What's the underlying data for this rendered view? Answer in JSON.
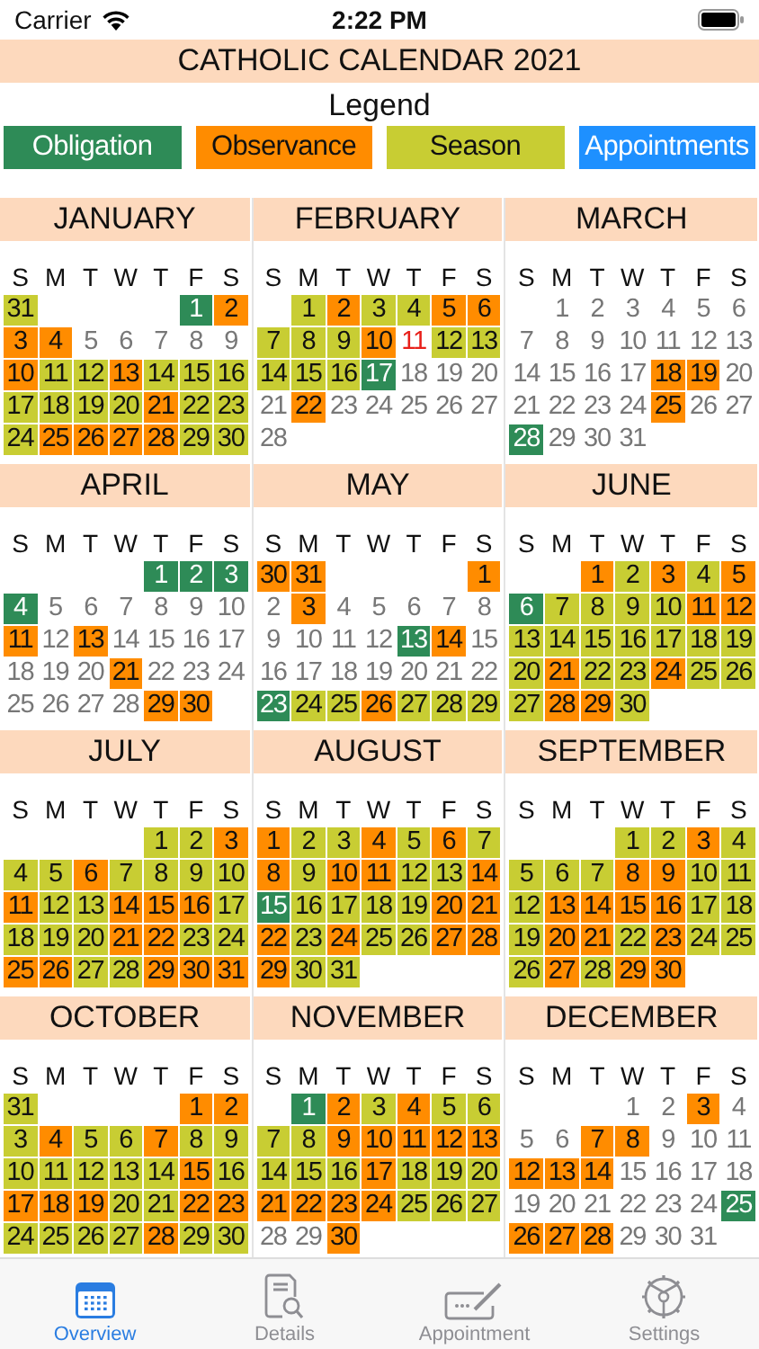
{
  "status_bar": {
    "carrier": "Carrier",
    "time": "2:22 PM"
  },
  "title": "CATHOLIC CALENDAR 2021",
  "legend": {
    "heading": "Legend",
    "items": [
      {
        "label": "Obligation",
        "kind": "obligation"
      },
      {
        "label": "Observance",
        "kind": "observance"
      },
      {
        "label": "Season",
        "kind": "season"
      },
      {
        "label": "Appointments",
        "kind": "appointment"
      }
    ]
  },
  "months": [
    {
      "name": "JANUARY",
      "weekdays": [
        "S",
        "M",
        "T",
        "W",
        "T",
        "F",
        "S"
      ],
      "weeks": [
        [
          {
            "day": "31",
            "kind": "season"
          },
          {
            "kind": "blank"
          },
          {
            "kind": "blank"
          },
          {
            "kind": "blank"
          },
          {
            "kind": "blank"
          },
          {
            "day": "1",
            "kind": "obligation"
          },
          {
            "day": "2",
            "kind": "observance"
          }
        ],
        [
          {
            "day": "3",
            "kind": "observance"
          },
          {
            "day": "4",
            "kind": "observance"
          },
          {
            "day": "5",
            "kind": "plain"
          },
          {
            "day": "6",
            "kind": "plain"
          },
          {
            "day": "7",
            "kind": "plain"
          },
          {
            "day": "8",
            "kind": "plain"
          },
          {
            "day": "9",
            "kind": "plain"
          }
        ],
        [
          {
            "day": "10",
            "kind": "observance"
          },
          {
            "day": "11",
            "kind": "season"
          },
          {
            "day": "12",
            "kind": "season"
          },
          {
            "day": "13",
            "kind": "observance"
          },
          {
            "day": "14",
            "kind": "season"
          },
          {
            "day": "15",
            "kind": "season"
          },
          {
            "day": "16",
            "kind": "season"
          }
        ],
        [
          {
            "day": "17",
            "kind": "season"
          },
          {
            "day": "18",
            "kind": "season"
          },
          {
            "day": "19",
            "kind": "season"
          },
          {
            "day": "20",
            "kind": "season"
          },
          {
            "day": "21",
            "kind": "observance"
          },
          {
            "day": "22",
            "kind": "season"
          },
          {
            "day": "23",
            "kind": "season"
          }
        ],
        [
          {
            "day": "24",
            "kind": "season"
          },
          {
            "day": "25",
            "kind": "observance"
          },
          {
            "day": "26",
            "kind": "observance"
          },
          {
            "day": "27",
            "kind": "observance"
          },
          {
            "day": "28",
            "kind": "observance"
          },
          {
            "day": "29",
            "kind": "season"
          },
          {
            "day": "30",
            "kind": "season"
          }
        ]
      ]
    },
    {
      "name": "FEBRUARY",
      "weekdays": [
        "S",
        "M",
        "T",
        "W",
        "T",
        "F",
        "S"
      ],
      "weeks": [
        [
          {
            "kind": "blank"
          },
          {
            "day": "1",
            "kind": "season"
          },
          {
            "day": "2",
            "kind": "observance"
          },
          {
            "day": "3",
            "kind": "season"
          },
          {
            "day": "4",
            "kind": "season"
          },
          {
            "day": "5",
            "kind": "observance"
          },
          {
            "day": "6",
            "kind": "observance"
          }
        ],
        [
          {
            "day": "7",
            "kind": "season"
          },
          {
            "day": "8",
            "kind": "season"
          },
          {
            "day": "9",
            "kind": "season"
          },
          {
            "day": "10",
            "kind": "observance"
          },
          {
            "day": "11",
            "kind": "highlight"
          },
          {
            "day": "12",
            "kind": "season"
          },
          {
            "day": "13",
            "kind": "season"
          }
        ],
        [
          {
            "day": "14",
            "kind": "season"
          },
          {
            "day": "15",
            "kind": "season"
          },
          {
            "day": "16",
            "kind": "season"
          },
          {
            "day": "17",
            "kind": "obligation"
          },
          {
            "day": "18",
            "kind": "plain"
          },
          {
            "day": "19",
            "kind": "plain"
          },
          {
            "day": "20",
            "kind": "plain"
          }
        ],
        [
          {
            "day": "21",
            "kind": "plain"
          },
          {
            "day": "22",
            "kind": "observance"
          },
          {
            "day": "23",
            "kind": "plain"
          },
          {
            "day": "24",
            "kind": "plain"
          },
          {
            "day": "25",
            "kind": "plain"
          },
          {
            "day": "26",
            "kind": "plain"
          },
          {
            "day": "27",
            "kind": "plain"
          }
        ],
        [
          {
            "day": "28",
            "kind": "plain"
          }
        ]
      ]
    },
    {
      "name": "MARCH",
      "weekdays": [
        "S",
        "M",
        "T",
        "W",
        "T",
        "F",
        "S"
      ],
      "weeks": [
        [
          {
            "kind": "blank"
          },
          {
            "day": "1",
            "kind": "plain"
          },
          {
            "day": "2",
            "kind": "plain"
          },
          {
            "day": "3",
            "kind": "plain"
          },
          {
            "day": "4",
            "kind": "plain"
          },
          {
            "day": "5",
            "kind": "plain"
          },
          {
            "day": "6",
            "kind": "plain"
          }
        ],
        [
          {
            "day": "7",
            "kind": "plain"
          },
          {
            "day": "8",
            "kind": "plain"
          },
          {
            "day": "9",
            "kind": "plain"
          },
          {
            "day": "10",
            "kind": "plain"
          },
          {
            "day": "11",
            "kind": "plain"
          },
          {
            "day": "12",
            "kind": "plain"
          },
          {
            "day": "13",
            "kind": "plain"
          }
        ],
        [
          {
            "day": "14",
            "kind": "plain"
          },
          {
            "day": "15",
            "kind": "plain"
          },
          {
            "day": "16",
            "kind": "plain"
          },
          {
            "day": "17",
            "kind": "plain"
          },
          {
            "day": "18",
            "kind": "observance"
          },
          {
            "day": "19",
            "kind": "observance"
          },
          {
            "day": "20",
            "kind": "plain"
          }
        ],
        [
          {
            "day": "21",
            "kind": "plain"
          },
          {
            "day": "22",
            "kind": "plain"
          },
          {
            "day": "23",
            "kind": "plain"
          },
          {
            "day": "24",
            "kind": "plain"
          },
          {
            "day": "25",
            "kind": "observance"
          },
          {
            "day": "26",
            "kind": "plain"
          },
          {
            "day": "27",
            "kind": "plain"
          }
        ],
        [
          {
            "day": "28",
            "kind": "obligation"
          },
          {
            "day": "29",
            "kind": "plain"
          },
          {
            "day": "30",
            "kind": "plain"
          },
          {
            "day": "31",
            "kind": "plain"
          }
        ]
      ]
    },
    {
      "name": "APRIL",
      "weekdays": [
        "S",
        "M",
        "T",
        "W",
        "T",
        "F",
        "S"
      ],
      "weeks": [
        [
          {
            "kind": "blank"
          },
          {
            "kind": "blank"
          },
          {
            "kind": "blank"
          },
          {
            "kind": "blank"
          },
          {
            "day": "1",
            "kind": "obligation"
          },
          {
            "day": "2",
            "kind": "obligation"
          },
          {
            "day": "3",
            "kind": "obligation"
          }
        ],
        [
          {
            "day": "4",
            "kind": "obligation"
          },
          {
            "day": "5",
            "kind": "plain"
          },
          {
            "day": "6",
            "kind": "plain"
          },
          {
            "day": "7",
            "kind": "plain"
          },
          {
            "day": "8",
            "kind": "plain"
          },
          {
            "day": "9",
            "kind": "plain"
          },
          {
            "day": "10",
            "kind": "plain"
          }
        ],
        [
          {
            "day": "11",
            "kind": "observance"
          },
          {
            "day": "12",
            "kind": "plain"
          },
          {
            "day": "13",
            "kind": "observance"
          },
          {
            "day": "14",
            "kind": "plain"
          },
          {
            "day": "15",
            "kind": "plain"
          },
          {
            "day": "16",
            "kind": "plain"
          },
          {
            "day": "17",
            "kind": "plain"
          }
        ],
        [
          {
            "day": "18",
            "kind": "plain"
          },
          {
            "day": "19",
            "kind": "plain"
          },
          {
            "day": "20",
            "kind": "plain"
          },
          {
            "day": "21",
            "kind": "observance"
          },
          {
            "day": "22",
            "kind": "plain"
          },
          {
            "day": "23",
            "kind": "plain"
          },
          {
            "day": "24",
            "kind": "plain"
          }
        ],
        [
          {
            "day": "25",
            "kind": "plain"
          },
          {
            "day": "26",
            "kind": "plain"
          },
          {
            "day": "27",
            "kind": "plain"
          },
          {
            "day": "28",
            "kind": "plain"
          },
          {
            "day": "29",
            "kind": "observance"
          },
          {
            "day": "30",
            "kind": "observance"
          }
        ]
      ]
    },
    {
      "name": "MAY",
      "weekdays": [
        "S",
        "M",
        "T",
        "W",
        "T",
        "F",
        "S"
      ],
      "weeks": [
        [
          {
            "day": "30",
            "kind": "observance"
          },
          {
            "day": "31",
            "kind": "observance"
          },
          {
            "kind": "blank"
          },
          {
            "kind": "blank"
          },
          {
            "kind": "blank"
          },
          {
            "kind": "blank"
          },
          {
            "day": "1",
            "kind": "observance"
          }
        ],
        [
          {
            "day": "2",
            "kind": "plain"
          },
          {
            "day": "3",
            "kind": "observance"
          },
          {
            "day": "4",
            "kind": "plain"
          },
          {
            "day": "5",
            "kind": "plain"
          },
          {
            "day": "6",
            "kind": "plain"
          },
          {
            "day": "7",
            "kind": "plain"
          },
          {
            "day": "8",
            "kind": "plain"
          }
        ],
        [
          {
            "day": "9",
            "kind": "plain"
          },
          {
            "day": "10",
            "kind": "plain"
          },
          {
            "day": "11",
            "kind": "plain"
          },
          {
            "day": "12",
            "kind": "plain"
          },
          {
            "day": "13",
            "kind": "obligation"
          },
          {
            "day": "14",
            "kind": "observance"
          },
          {
            "day": "15",
            "kind": "plain"
          }
        ],
        [
          {
            "day": "16",
            "kind": "plain"
          },
          {
            "day": "17",
            "kind": "plain"
          },
          {
            "day": "18",
            "kind": "plain"
          },
          {
            "day": "19",
            "kind": "plain"
          },
          {
            "day": "20",
            "kind": "plain"
          },
          {
            "day": "21",
            "kind": "plain"
          },
          {
            "day": "22",
            "kind": "plain"
          }
        ],
        [
          {
            "day": "23",
            "kind": "obligation"
          },
          {
            "day": "24",
            "kind": "season"
          },
          {
            "day": "25",
            "kind": "season"
          },
          {
            "day": "26",
            "kind": "observance"
          },
          {
            "day": "27",
            "kind": "season"
          },
          {
            "day": "28",
            "kind": "season"
          },
          {
            "day": "29",
            "kind": "season"
          }
        ]
      ]
    },
    {
      "name": "JUNE",
      "weekdays": [
        "S",
        "M",
        "T",
        "W",
        "T",
        "F",
        "S"
      ],
      "weeks": [
        [
          {
            "kind": "blank"
          },
          {
            "kind": "blank"
          },
          {
            "day": "1",
            "kind": "observance"
          },
          {
            "day": "2",
            "kind": "season"
          },
          {
            "day": "3",
            "kind": "observance"
          },
          {
            "day": "4",
            "kind": "season"
          },
          {
            "day": "5",
            "kind": "observance"
          }
        ],
        [
          {
            "day": "6",
            "kind": "obligation"
          },
          {
            "day": "7",
            "kind": "season"
          },
          {
            "day": "8",
            "kind": "season"
          },
          {
            "day": "9",
            "kind": "season"
          },
          {
            "day": "10",
            "kind": "season"
          },
          {
            "day": "11",
            "kind": "observance"
          },
          {
            "day": "12",
            "kind": "observance"
          }
        ],
        [
          {
            "day": "13",
            "kind": "season"
          },
          {
            "day": "14",
            "kind": "season"
          },
          {
            "day": "15",
            "kind": "season"
          },
          {
            "day": "16",
            "kind": "season"
          },
          {
            "day": "17",
            "kind": "season"
          },
          {
            "day": "18",
            "kind": "season"
          },
          {
            "day": "19",
            "kind": "season"
          }
        ],
        [
          {
            "day": "20",
            "kind": "season"
          },
          {
            "day": "21",
            "kind": "observance"
          },
          {
            "day": "22",
            "kind": "season"
          },
          {
            "day": "23",
            "kind": "season"
          },
          {
            "day": "24",
            "kind": "observance"
          },
          {
            "day": "25",
            "kind": "season"
          },
          {
            "day": "26",
            "kind": "season"
          }
        ],
        [
          {
            "day": "27",
            "kind": "season"
          },
          {
            "day": "28",
            "kind": "observance"
          },
          {
            "day": "29",
            "kind": "observance"
          },
          {
            "day": "30",
            "kind": "season"
          }
        ]
      ]
    },
    {
      "name": "JULY",
      "weekdays": [
        "S",
        "M",
        "T",
        "W",
        "T",
        "F",
        "S"
      ],
      "weeks": [
        [
          {
            "kind": "blank"
          },
          {
            "kind": "blank"
          },
          {
            "kind": "blank"
          },
          {
            "kind": "blank"
          },
          {
            "day": "1",
            "kind": "season"
          },
          {
            "day": "2",
            "kind": "season"
          },
          {
            "day": "3",
            "kind": "observance"
          }
        ],
        [
          {
            "day": "4",
            "kind": "season"
          },
          {
            "day": "5",
            "kind": "season"
          },
          {
            "day": "6",
            "kind": "observance"
          },
          {
            "day": "7",
            "kind": "season"
          },
          {
            "day": "8",
            "kind": "season"
          },
          {
            "day": "9",
            "kind": "season"
          },
          {
            "day": "10",
            "kind": "season"
          }
        ],
        [
          {
            "day": "11",
            "kind": "observance"
          },
          {
            "day": "12",
            "kind": "season"
          },
          {
            "day": "13",
            "kind": "season"
          },
          {
            "day": "14",
            "kind": "observance"
          },
          {
            "day": "15",
            "kind": "observance"
          },
          {
            "day": "16",
            "kind": "observance"
          },
          {
            "day": "17",
            "kind": "season"
          }
        ],
        [
          {
            "day": "18",
            "kind": "season"
          },
          {
            "day": "19",
            "kind": "season"
          },
          {
            "day": "20",
            "kind": "season"
          },
          {
            "day": "21",
            "kind": "observance"
          },
          {
            "day": "22",
            "kind": "observance"
          },
          {
            "day": "23",
            "kind": "season"
          },
          {
            "day": "24",
            "kind": "season"
          }
        ],
        [
          {
            "day": "25",
            "kind": "observance"
          },
          {
            "day": "26",
            "kind": "observance"
          },
          {
            "day": "27",
            "kind": "season"
          },
          {
            "day": "28",
            "kind": "season"
          },
          {
            "day": "29",
            "kind": "observance"
          },
          {
            "day": "30",
            "kind": "observance"
          },
          {
            "day": "31",
            "kind": "observance"
          }
        ]
      ]
    },
    {
      "name": "AUGUST",
      "weekdays": [
        "S",
        "M",
        "T",
        "W",
        "T",
        "F",
        "S"
      ],
      "weeks": [
        [
          {
            "day": "1",
            "kind": "observance"
          },
          {
            "day": "2",
            "kind": "season"
          },
          {
            "day": "3",
            "kind": "season"
          },
          {
            "day": "4",
            "kind": "observance"
          },
          {
            "day": "5",
            "kind": "season"
          },
          {
            "day": "6",
            "kind": "observance"
          },
          {
            "day": "7",
            "kind": "season"
          }
        ],
        [
          {
            "day": "8",
            "kind": "observance"
          },
          {
            "day": "9",
            "kind": "season"
          },
          {
            "day": "10",
            "kind": "observance"
          },
          {
            "day": "11",
            "kind": "observance"
          },
          {
            "day": "12",
            "kind": "season"
          },
          {
            "day": "13",
            "kind": "season"
          },
          {
            "day": "14",
            "kind": "observance"
          }
        ],
        [
          {
            "day": "15",
            "kind": "obligation"
          },
          {
            "day": "16",
            "kind": "season"
          },
          {
            "day": "17",
            "kind": "season"
          },
          {
            "day": "18",
            "kind": "season"
          },
          {
            "day": "19",
            "kind": "season"
          },
          {
            "day": "20",
            "kind": "observance"
          },
          {
            "day": "21",
            "kind": "observance"
          }
        ],
        [
          {
            "day": "22",
            "kind": "observance"
          },
          {
            "day": "23",
            "kind": "season"
          },
          {
            "day": "24",
            "kind": "observance"
          },
          {
            "day": "25",
            "kind": "season"
          },
          {
            "day": "26",
            "kind": "season"
          },
          {
            "day": "27",
            "kind": "observance"
          },
          {
            "day": "28",
            "kind": "observance"
          }
        ],
        [
          {
            "day": "29",
            "kind": "observance"
          },
          {
            "day": "30",
            "kind": "season"
          },
          {
            "day": "31",
            "kind": "season"
          }
        ]
      ]
    },
    {
      "name": "SEPTEMBER",
      "weekdays": [
        "S",
        "M",
        "T",
        "W",
        "T",
        "F",
        "S"
      ],
      "weeks": [
        [
          {
            "kind": "blank"
          },
          {
            "kind": "blank"
          },
          {
            "kind": "blank"
          },
          {
            "day": "1",
            "kind": "season"
          },
          {
            "day": "2",
            "kind": "season"
          },
          {
            "day": "3",
            "kind": "observance"
          },
          {
            "day": "4",
            "kind": "season"
          }
        ],
        [
          {
            "day": "5",
            "kind": "season"
          },
          {
            "day": "6",
            "kind": "season"
          },
          {
            "day": "7",
            "kind": "season"
          },
          {
            "day": "8",
            "kind": "observance"
          },
          {
            "day": "9",
            "kind": "observance"
          },
          {
            "day": "10",
            "kind": "season"
          },
          {
            "day": "11",
            "kind": "season"
          }
        ],
        [
          {
            "day": "12",
            "kind": "season"
          },
          {
            "day": "13",
            "kind": "observance"
          },
          {
            "day": "14",
            "kind": "observance"
          },
          {
            "day": "15",
            "kind": "observance"
          },
          {
            "day": "16",
            "kind": "observance"
          },
          {
            "day": "17",
            "kind": "season"
          },
          {
            "day": "18",
            "kind": "season"
          }
        ],
        [
          {
            "day": "19",
            "kind": "season"
          },
          {
            "day": "20",
            "kind": "observance"
          },
          {
            "day": "21",
            "kind": "observance"
          },
          {
            "day": "22",
            "kind": "season"
          },
          {
            "day": "23",
            "kind": "observance"
          },
          {
            "day": "24",
            "kind": "season"
          },
          {
            "day": "25",
            "kind": "season"
          }
        ],
        [
          {
            "day": "26",
            "kind": "season"
          },
          {
            "day": "27",
            "kind": "observance"
          },
          {
            "day": "28",
            "kind": "season"
          },
          {
            "day": "29",
            "kind": "observance"
          },
          {
            "day": "30",
            "kind": "observance"
          }
        ]
      ]
    },
    {
      "name": "OCTOBER",
      "weekdays": [
        "S",
        "M",
        "T",
        "W",
        "T",
        "F",
        "S"
      ],
      "weeks": [
        [
          {
            "day": "31",
            "kind": "season"
          },
          {
            "kind": "blank"
          },
          {
            "kind": "blank"
          },
          {
            "kind": "blank"
          },
          {
            "kind": "blank"
          },
          {
            "day": "1",
            "kind": "observance"
          },
          {
            "day": "2",
            "kind": "observance"
          }
        ],
        [
          {
            "day": "3",
            "kind": "season"
          },
          {
            "day": "4",
            "kind": "observance"
          },
          {
            "day": "5",
            "kind": "season"
          },
          {
            "day": "6",
            "kind": "season"
          },
          {
            "day": "7",
            "kind": "observance"
          },
          {
            "day": "8",
            "kind": "season"
          },
          {
            "day": "9",
            "kind": "season"
          }
        ],
        [
          {
            "day": "10",
            "kind": "season"
          },
          {
            "day": "11",
            "kind": "season"
          },
          {
            "day": "12",
            "kind": "season"
          },
          {
            "day": "13",
            "kind": "season"
          },
          {
            "day": "14",
            "kind": "season"
          },
          {
            "day": "15",
            "kind": "observance"
          },
          {
            "day": "16",
            "kind": "season"
          }
        ],
        [
          {
            "day": "17",
            "kind": "observance"
          },
          {
            "day": "18",
            "kind": "observance"
          },
          {
            "day": "19",
            "kind": "observance"
          },
          {
            "day": "20",
            "kind": "season"
          },
          {
            "day": "21",
            "kind": "season"
          },
          {
            "day": "22",
            "kind": "observance"
          },
          {
            "day": "23",
            "kind": "observance"
          }
        ],
        [
          {
            "day": "24",
            "kind": "season"
          },
          {
            "day": "25",
            "kind": "season"
          },
          {
            "day": "26",
            "kind": "season"
          },
          {
            "day": "27",
            "kind": "season"
          },
          {
            "day": "28",
            "kind": "observance"
          },
          {
            "day": "29",
            "kind": "season"
          },
          {
            "day": "30",
            "kind": "season"
          }
        ]
      ]
    },
    {
      "name": "NOVEMBER",
      "weekdays": [
        "S",
        "M",
        "T",
        "W",
        "T",
        "F",
        "S"
      ],
      "weeks": [
        [
          {
            "kind": "blank"
          },
          {
            "day": "1",
            "kind": "obligation"
          },
          {
            "day": "2",
            "kind": "observance"
          },
          {
            "day": "3",
            "kind": "season"
          },
          {
            "day": "4",
            "kind": "observance"
          },
          {
            "day": "5",
            "kind": "season"
          },
          {
            "day": "6",
            "kind": "season"
          }
        ],
        [
          {
            "day": "7",
            "kind": "season"
          },
          {
            "day": "8",
            "kind": "season"
          },
          {
            "day": "9",
            "kind": "observance"
          },
          {
            "day": "10",
            "kind": "observance"
          },
          {
            "day": "11",
            "kind": "observance"
          },
          {
            "day": "12",
            "kind": "observance"
          },
          {
            "day": "13",
            "kind": "observance"
          }
        ],
        [
          {
            "day": "14",
            "kind": "season"
          },
          {
            "day": "15",
            "kind": "season"
          },
          {
            "day": "16",
            "kind": "season"
          },
          {
            "day": "17",
            "kind": "observance"
          },
          {
            "day": "18",
            "kind": "season"
          },
          {
            "day": "19",
            "kind": "season"
          },
          {
            "day": "20",
            "kind": "season"
          }
        ],
        [
          {
            "day": "21",
            "kind": "observance"
          },
          {
            "day": "22",
            "kind": "observance"
          },
          {
            "day": "23",
            "kind": "observance"
          },
          {
            "day": "24",
            "kind": "observance"
          },
          {
            "day": "25",
            "kind": "season"
          },
          {
            "day": "26",
            "kind": "season"
          },
          {
            "day": "27",
            "kind": "season"
          }
        ],
        [
          {
            "day": "28",
            "kind": "plain"
          },
          {
            "day": "29",
            "kind": "plain"
          },
          {
            "day": "30",
            "kind": "observance"
          }
        ]
      ]
    },
    {
      "name": "DECEMBER",
      "weekdays": [
        "S",
        "M",
        "T",
        "W",
        "T",
        "F",
        "S"
      ],
      "weeks": [
        [
          {
            "kind": "blank"
          },
          {
            "kind": "blank"
          },
          {
            "kind": "blank"
          },
          {
            "day": "1",
            "kind": "plain"
          },
          {
            "day": "2",
            "kind": "plain"
          },
          {
            "day": "3",
            "kind": "observance"
          },
          {
            "day": "4",
            "kind": "plain"
          }
        ],
        [
          {
            "day": "5",
            "kind": "plain"
          },
          {
            "day": "6",
            "kind": "plain"
          },
          {
            "day": "7",
            "kind": "observance"
          },
          {
            "day": "8",
            "kind": "observance"
          },
          {
            "day": "9",
            "kind": "plain"
          },
          {
            "day": "10",
            "kind": "plain"
          },
          {
            "day": "11",
            "kind": "plain"
          }
        ],
        [
          {
            "day": "12",
            "kind": "observance"
          },
          {
            "day": "13",
            "kind": "observance"
          },
          {
            "day": "14",
            "kind": "observance"
          },
          {
            "day": "15",
            "kind": "plain"
          },
          {
            "day": "16",
            "kind": "plain"
          },
          {
            "day": "17",
            "kind": "plain"
          },
          {
            "day": "18",
            "kind": "plain"
          }
        ],
        [
          {
            "day": "19",
            "kind": "plain"
          },
          {
            "day": "20",
            "kind": "plain"
          },
          {
            "day": "21",
            "kind": "plain"
          },
          {
            "day": "22",
            "kind": "plain"
          },
          {
            "day": "23",
            "kind": "plain"
          },
          {
            "day": "24",
            "kind": "plain"
          },
          {
            "day": "25",
            "kind": "obligation"
          }
        ],
        [
          {
            "day": "26",
            "kind": "observance"
          },
          {
            "day": "27",
            "kind": "observance"
          },
          {
            "day": "28",
            "kind": "observance"
          },
          {
            "day": "29",
            "kind": "plain"
          },
          {
            "day": "30",
            "kind": "plain"
          },
          {
            "day": "31",
            "kind": "plain"
          }
        ]
      ]
    }
  ],
  "tab_bar": [
    {
      "label": "Overview",
      "selected": true
    },
    {
      "label": "Details",
      "selected": false
    },
    {
      "label": "Appointment",
      "selected": false
    },
    {
      "label": "Settings",
      "selected": false
    }
  ]
}
